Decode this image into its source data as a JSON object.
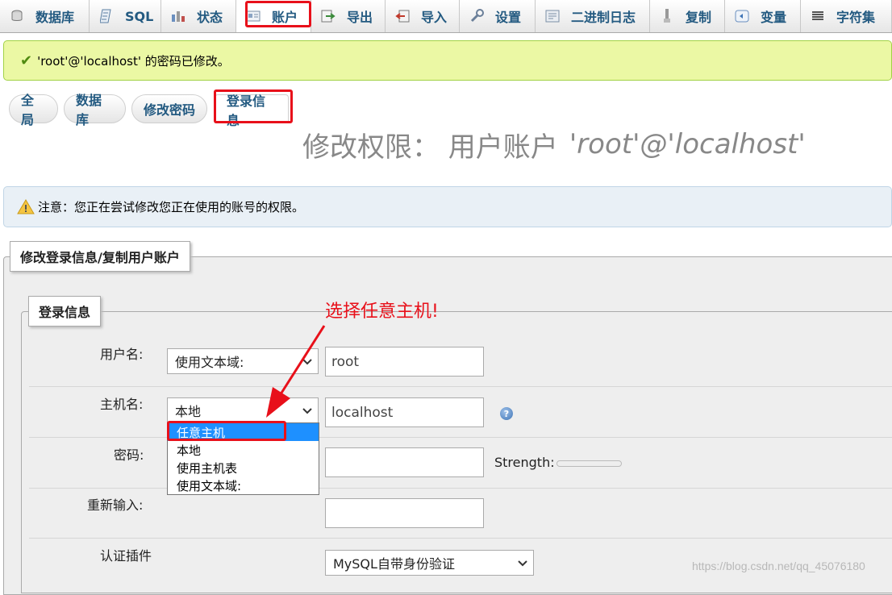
{
  "nav": {
    "tabs": [
      {
        "label": "数据库",
        "icon": "database-icon"
      },
      {
        "label": "SQL",
        "icon": "sql-icon"
      },
      {
        "label": "状态",
        "icon": "status-icon"
      },
      {
        "label": "账户",
        "icon": "accounts-icon",
        "active": true
      },
      {
        "label": "导出",
        "icon": "export-icon"
      },
      {
        "label": "导入",
        "icon": "import-icon"
      },
      {
        "label": "设置",
        "icon": "settings-icon"
      },
      {
        "label": "二进制日志",
        "icon": "binlog-icon"
      },
      {
        "label": "复制",
        "icon": "replication-icon"
      },
      {
        "label": "变量",
        "icon": "variables-icon"
      },
      {
        "label": "字符集",
        "icon": "charset-icon"
      }
    ]
  },
  "success_message": "'root'@'localhost' 的密码已修改。",
  "subtabs": [
    "全局",
    "数据库",
    "修改密码",
    "登录信息"
  ],
  "title": {
    "prefix": "修改权限：  用户账户",
    "account": "'root'@'localhost'"
  },
  "notice": "注意：您正在尝试修改您正在使用的账号的权限。",
  "outer_legend": "修改登录信息/复制用户账户",
  "inner_legend": "登录信息",
  "annotation": "选择任意主机!",
  "form": {
    "username": {
      "label": "用户名:",
      "select": "使用文本域:",
      "value": "root"
    },
    "host": {
      "label": "主机名:",
      "select": "本地",
      "value": "localhost",
      "options": [
        "任意主机",
        "本地",
        "使用主机表",
        "使用文本域:"
      ],
      "highlighted": "任意主机"
    },
    "password": {
      "label": "密码:",
      "strength_label": "Strength:"
    },
    "retype": {
      "label": "重新输入:"
    },
    "auth_plugin": {
      "label": "认证插件",
      "value": "MySQL自带身份验证"
    }
  },
  "watermark": "https://blog.csdn.net/qq_45076180",
  "colors": {
    "nav_text": "#235a81",
    "success_bg": "#ebf8a4",
    "notice_bg": "#e9f0f6",
    "annotation_red": "#e8101a",
    "highlight": "#1e90ff"
  }
}
